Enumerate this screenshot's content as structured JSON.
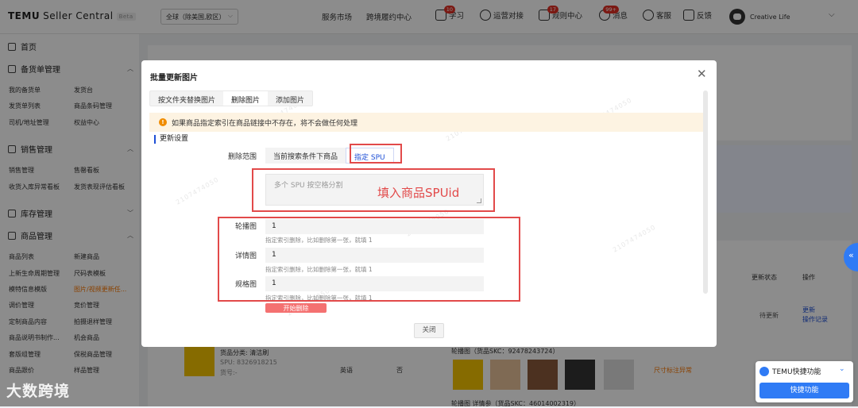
{
  "topbar": {
    "logo": "TEMU",
    "app_name": "Seller Central",
    "beta": "Beta",
    "region": "全球（除美国,欧区）",
    "nav": [
      "服务市场",
      "跨境履约中心"
    ],
    "links": [
      {
        "label": "学习",
        "badge": "10"
      },
      {
        "label": "运营对接",
        "badge": ""
      },
      {
        "label": "规则中心",
        "badge": "17"
      },
      {
        "label": "消息",
        "badge": "99+"
      },
      {
        "label": "客服",
        "badge": ""
      },
      {
        "label": "反馈",
        "badge": ""
      }
    ],
    "user": "Creative Life"
  },
  "sidebar": {
    "home": "首页",
    "groups": [
      {
        "title": "备货单管理",
        "items": [
          "我的备货单",
          "发货台",
          "发货单列表",
          "商品条码管理",
          "司机/地址管理",
          "权益中心"
        ]
      },
      {
        "title": "销售管理",
        "items": [
          "销售管理",
          "售罄看板",
          "收货入库异常看板",
          "发货表现评估看板"
        ]
      },
      {
        "title": "库存管理",
        "items": []
      },
      {
        "title": "商品管理",
        "items": [
          "商品列表",
          "新建商品",
          "上新生命周期管理",
          "尺码表模板",
          "模特信息模版",
          "图片/视频更新任...",
          "调价管理",
          "竞价管理",
          "定制商品内容",
          "拍摄退样管理",
          "商品说明书制作...",
          "机会商品",
          "套版组管理",
          "保税商品管理",
          "商品跟价",
          "样品管理"
        ]
      }
    ]
  },
  "background": {
    "col_update_status": "更新状态",
    "col_action": "操作",
    "status": "待更新",
    "link_update": "更新",
    "link_log": "操作记录",
    "row_category": "货品分类: 清洁刷",
    "row_spu": "SPU: 8326918215",
    "row_sku": "货号:-",
    "row_lang": "英语",
    "row_no": "否",
    "row_carousel": "轮播图（货品SKC：92478243724）",
    "row_abnormal": "尺寸标注异常",
    "row_next": "轮播图 详情参（货品SKC：46014002319）"
  },
  "dialog": {
    "title": "批量更新图片",
    "tabs": [
      "按文件夹替换图片",
      "删除图片",
      "添加图片"
    ],
    "active_tab": 1,
    "alert": "如果商品指定索引在商品链接中不存在，将不会做任何处理",
    "section": "更新设置",
    "scope_label": "删除范围",
    "scope_options": [
      "当前搜索条件下商品",
      "指定 SPU"
    ],
    "spu_placeholder": "多个 SPU 按空格分割",
    "fill_note": "填入商品SPUid",
    "fields": [
      {
        "label": "轮播图",
        "value": "1",
        "hint": "指定索引删除，比如删除第一张，就填 1"
      },
      {
        "label": "详情图",
        "value": "1",
        "hint": "指定索引删除，比如删除第一张，就填 1"
      },
      {
        "label": "规格图",
        "value": "1",
        "hint": "指定索引删除，比如删除第一张，就填 1"
      }
    ],
    "start_button": "开始删除",
    "close_button": "关闭"
  },
  "quick": {
    "title": "TEMU快捷功能",
    "button": "快捷功能"
  },
  "watermark": "大数跨境",
  "colors": {
    "accent": "#1e4fd6",
    "brand_orange": "#fb7701",
    "annotation_red": "#e24a4a",
    "quick_blue": "#2f7bf5"
  }
}
